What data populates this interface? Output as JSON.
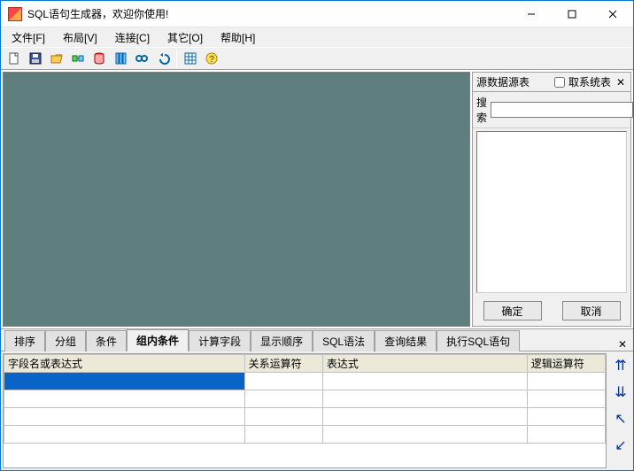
{
  "title": "SQL语句生成器，欢迎你使用!",
  "menu": {
    "file": "文件[F]",
    "layout": "布局[V]",
    "connect": "连接[C]",
    "other": "其它[O]",
    "help": "帮助[H]"
  },
  "rightpanel": {
    "header_label": "源数据源表",
    "checkbox_label": "取系统表",
    "search_label": "搜索",
    "search_value": "",
    "ok": "确定",
    "cancel": "取消"
  },
  "tabs": {
    "sort": "排序",
    "group": "分组",
    "cond": "条件",
    "inner_cond": "组内条件",
    "calc": "计算字段",
    "display": "显示顺序",
    "sql": "SQL语法",
    "result": "查询结果",
    "exec": "执行SQL语句"
  },
  "grid": {
    "columns": {
      "field": "字段名或表达式",
      "op": "关系运算符",
      "expr": "表达式",
      "logic": "逻辑运算符"
    },
    "rows": [
      {
        "field": "",
        "op": "",
        "expr": "",
        "logic": ""
      },
      {
        "field": "",
        "op": "",
        "expr": "",
        "logic": ""
      },
      {
        "field": "",
        "op": "",
        "expr": "",
        "logic": ""
      },
      {
        "field": "",
        "op": "",
        "expr": "",
        "logic": ""
      }
    ]
  },
  "sidebuttons": {
    "move_top": "⇈",
    "move_bottom": "⇊",
    "move_up": "↖",
    "move_down": "↙"
  }
}
